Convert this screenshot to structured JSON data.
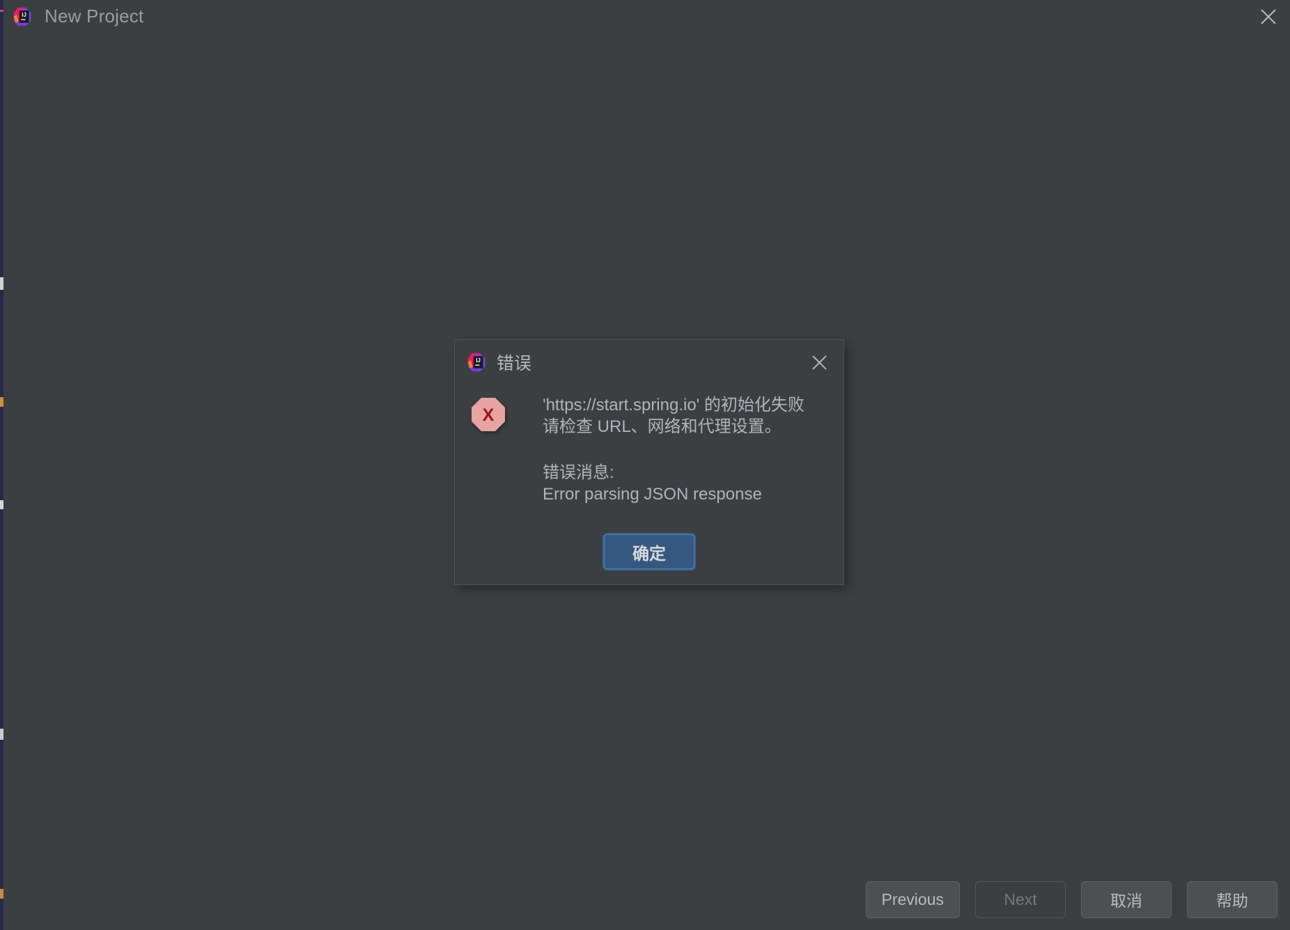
{
  "window": {
    "title": "New Project",
    "app_icon": "intellij-idea-icon",
    "close_icon": "close-icon",
    "background_color": "#3c3f41",
    "edge_strip_color": "#262a47"
  },
  "footer": {
    "buttons": [
      {
        "label": "Previous",
        "name": "previous-button",
        "disabled": false
      },
      {
        "label": "Next",
        "name": "next-button",
        "disabled": true
      },
      {
        "label": "取消",
        "name": "cancel-button",
        "disabled": false
      },
      {
        "label": "帮助",
        "name": "help-button",
        "disabled": false
      }
    ]
  },
  "dialog": {
    "title": "错误",
    "app_icon": "intellij-idea-icon",
    "close_icon": "close-icon",
    "status_icon": "error-octagon-icon",
    "message_line1": "'https://start.spring.io' 的初始化失败",
    "message_line2": "请检查 URL、网络和代理设置。",
    "detail_label": "错误消息:",
    "detail_value": "Error parsing JSON response",
    "ok_label": "确定",
    "ok_button_color": "#365880",
    "ok_focus_border_color": "#4a83c0",
    "error_icon_fill": "#e8a3a3",
    "error_icon_glyph": "#9c1515"
  }
}
